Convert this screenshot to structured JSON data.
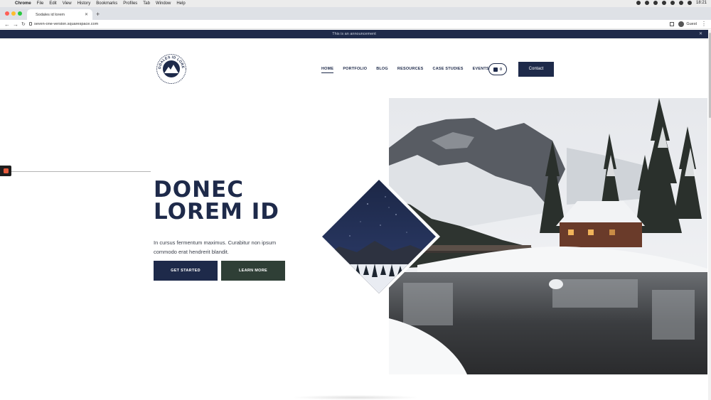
{
  "menubar": {
    "items": [
      "Chrome",
      "File",
      "Edit",
      "View",
      "History",
      "Bookmarks",
      "Profiles",
      "Tab",
      "Window",
      "Help"
    ],
    "clock": "18:21"
  },
  "browser": {
    "tab_title": "Sodales id lorem",
    "url": "seven-one-version.squarespace.com",
    "profile_label": "Guest"
  },
  "announcement": {
    "text": "This is an announcement"
  },
  "header": {
    "logo_text": "SODALES ID LOREM",
    "nav": [
      "HOME",
      "PORTFOLIO",
      "BLOG",
      "RESOURCES",
      "CASE STUDIES",
      "EVENTS"
    ],
    "active_nav": "HOME",
    "cart_count": "0",
    "contact_label": "Contact"
  },
  "hero": {
    "headline_line1": "DONEC",
    "headline_line2": "LOREM ID",
    "body": "In cursus fermentum maximus. Curabitur non ipsum commodo erat hendrerit blandit.",
    "primary_button": "GET STARTED",
    "secondary_button": "LEARN MORE"
  },
  "colors": {
    "navy": "#1e2a4a",
    "forest": "#2f3f36",
    "accent_orange": "#e55a3c"
  }
}
